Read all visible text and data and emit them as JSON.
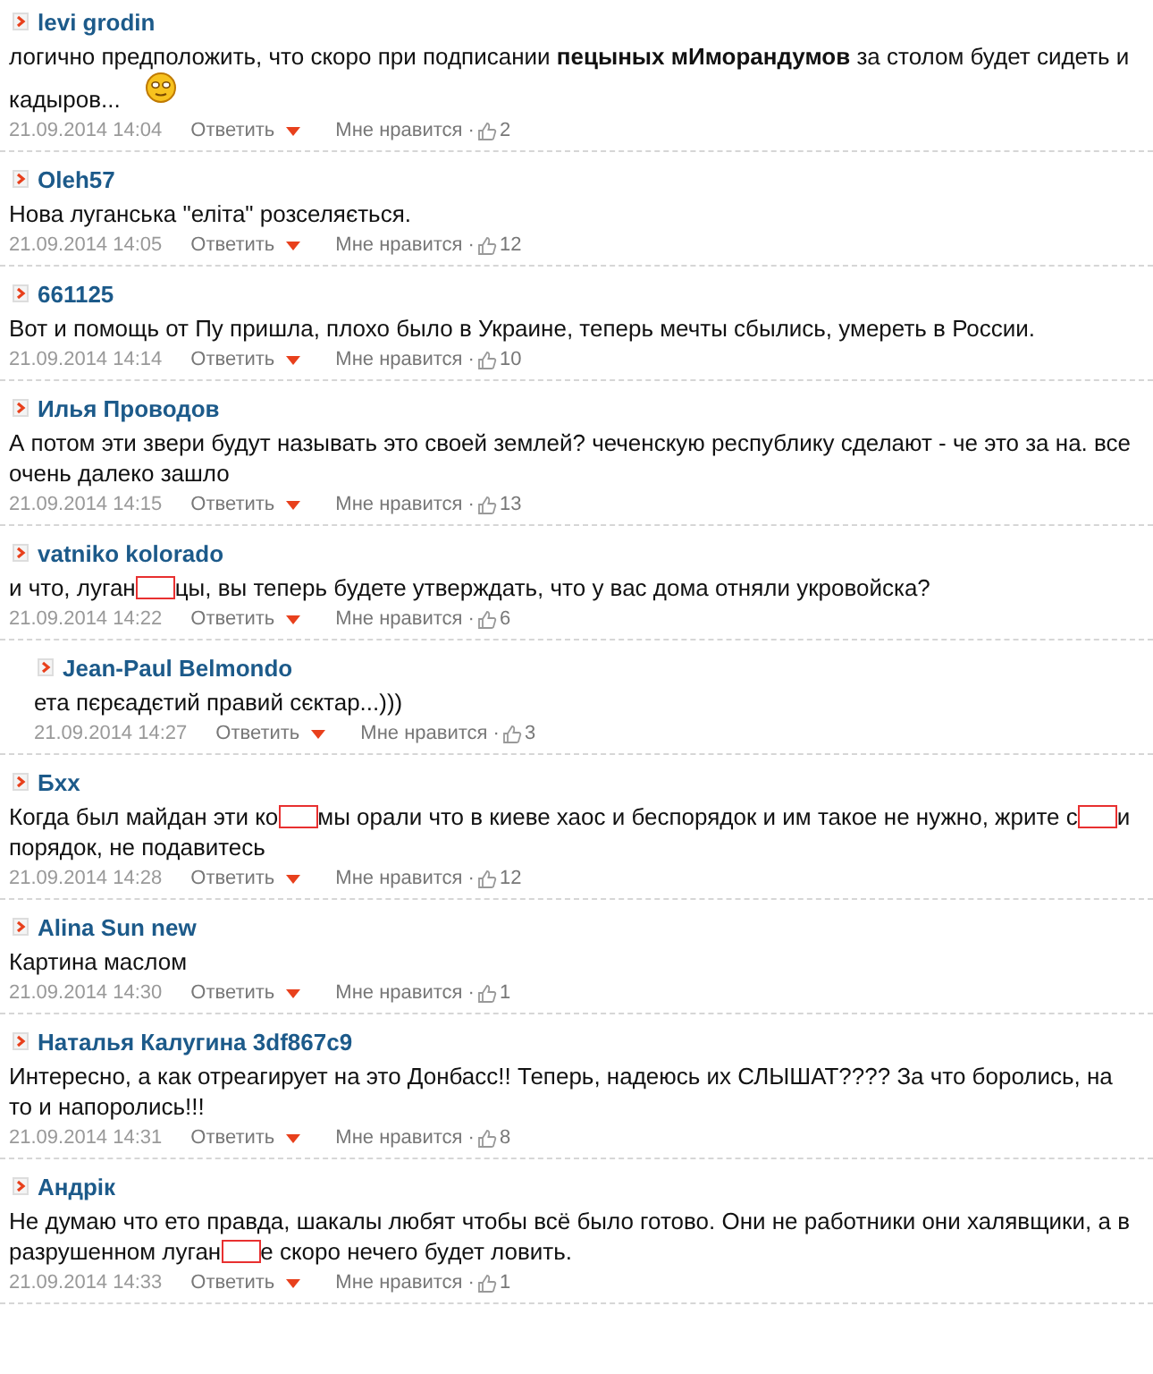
{
  "comments": [
    {
      "author": "levi grodin",
      "body": [
        {
          "kind": "text",
          "text": "логично предположить, что скоро при подписании **пецыных мИморандумов** за столом будет сидеть и кадыров... "
        },
        {
          "kind": "emoticon"
        }
      ],
      "time": "21.09.2014 14:04",
      "reply_label": "Ответить",
      "like_label": "Мне нравится ·",
      "likes": "2"
    },
    {
      "author": "Oleh57",
      "body": [
        {
          "kind": "text",
          "text": "Нова луганська \"еліта\" розселяється."
        }
      ],
      "time": "21.09.2014 14:05",
      "reply_label": "Ответить",
      "like_label": "Мне нравится ·",
      "likes": "12"
    },
    {
      "author": "661125",
      "body": [
        {
          "kind": "text",
          "text": "Вот и помощь от Пу пришла, плохо было в Украине, теперь мечты сбылись, умереть в России."
        }
      ],
      "time": "21.09.2014 14:14",
      "reply_label": "Ответить",
      "like_label": "Мне нравится ·",
      "likes": "10"
    },
    {
      "author": "Илья Проводов",
      "body": [
        {
          "kind": "text",
          "text": "А потом эти звери будут называть это своей землей? чеченскую республику сделают - че это за на. все очень далеко зашло"
        }
      ],
      "time": "21.09.2014 14:15",
      "reply_label": "Ответить",
      "like_label": "Мне нравится ·",
      "likes": "13"
    },
    {
      "author": "vatniko kolorado",
      "body": [
        {
          "kind": "text",
          "text": "и что, луган"
        },
        {
          "kind": "redaction"
        },
        {
          "kind": "text",
          "text": "цы, вы теперь будете утверждать, что у вас дома отняли укровойска?"
        }
      ],
      "time": "21.09.2014 14:22",
      "reply_label": "Ответить",
      "like_label": "Мне нравится ·",
      "likes": "6",
      "children": [
        {
          "author": "Jean-Paul Belmondo",
          "body": [
            {
              "kind": "text",
              "text": "ета пєрєадєтий правий сєктар...)))"
            }
          ],
          "time": "21.09.2014 14:27",
          "reply_label": "Ответить",
          "like_label": "Мне нравится ·",
          "likes": "3"
        }
      ]
    },
    {
      "author": "Бхх",
      "body": [
        {
          "kind": "text",
          "text": "Когда был майдан эти ко"
        },
        {
          "kind": "redaction"
        },
        {
          "kind": "text",
          "text": "мы орали что в киеве хаос и беспорядок и им такое не нужно, жрите с"
        },
        {
          "kind": "redaction"
        },
        {
          "kind": "text",
          "text": "и порядок, не подавитесь"
        }
      ],
      "time": "21.09.2014 14:28",
      "reply_label": "Ответить",
      "like_label": "Мне нравится ·",
      "likes": "12"
    },
    {
      "author": "Alina Sun new",
      "body": [
        {
          "kind": "text",
          "text": "Картина маслом"
        }
      ],
      "time": "21.09.2014 14:30",
      "reply_label": "Ответить",
      "like_label": "Мне нравится ·",
      "likes": "1"
    },
    {
      "author": "Наталья Калугина 3df867c9",
      "body": [
        {
          "kind": "text",
          "text": "Интересно, а как отреагирует на это Донбасс!! Теперь, надеюсь их СЛЫШАТ???? За что боролись, на то и напоролись!!!"
        }
      ],
      "time": "21.09.2014 14:31",
      "reply_label": "Ответить",
      "like_label": "Мне нравится ·",
      "likes": "8"
    },
    {
      "author": "Андрiк",
      "body": [
        {
          "kind": "text",
          "text": "Не думаю что ето правда, шакалы любят чтобы всё было готово. Они не работники они халявщики, а в разрушенном луган"
        },
        {
          "kind": "redaction"
        },
        {
          "kind": "text",
          "text": "е скоро нечего будет ловить."
        }
      ],
      "time": "21.09.2014 14:33",
      "reply_label": "Ответить",
      "like_label": "Мне нравится ·",
      "likes": "1"
    }
  ]
}
